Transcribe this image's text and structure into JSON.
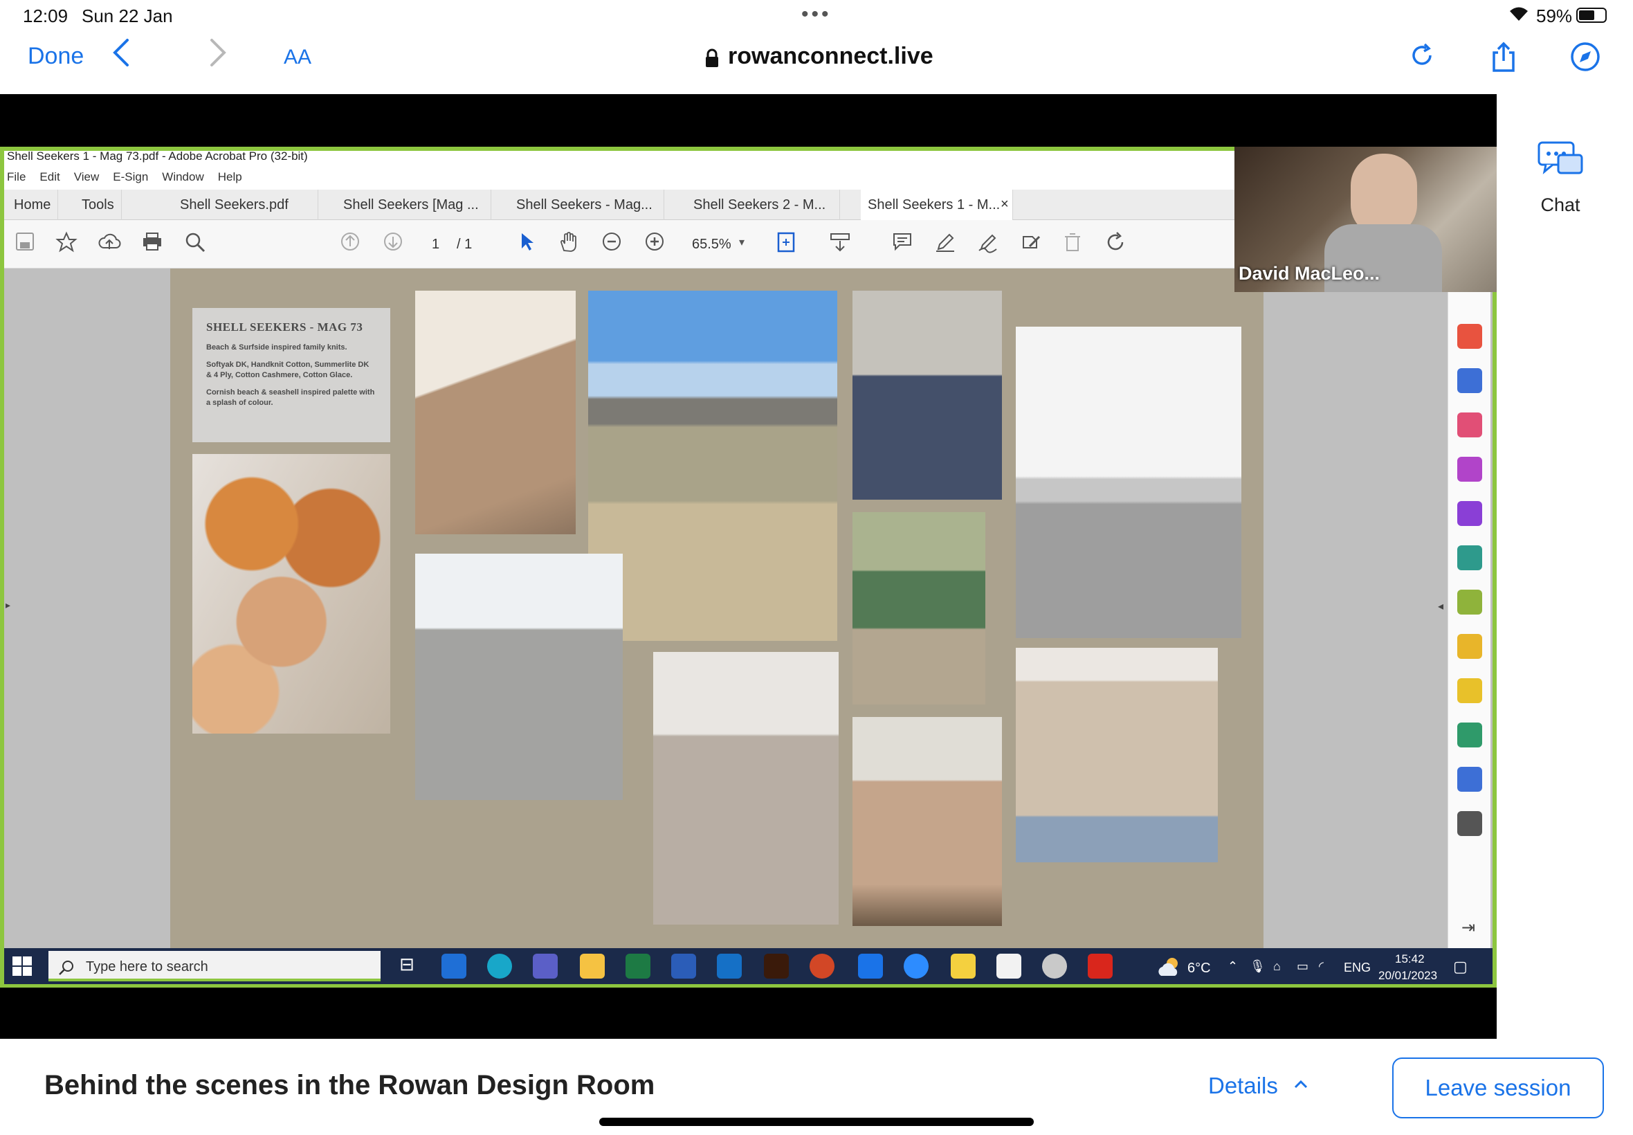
{
  "status_bar": {
    "time": "12:09",
    "date": "Sun 22 Jan",
    "battery": "59%"
  },
  "browser": {
    "done_label": "Done",
    "aa_label": "AA",
    "url": "rowanconnect.live"
  },
  "side_panel": {
    "chat_label": "Chat"
  },
  "acrobat": {
    "window_title": "Shell Seekers 1 - Mag 73.pdf - Adobe Acrobat Pro (32-bit)",
    "menu": [
      "File",
      "Edit",
      "View",
      "E-Sign",
      "Window",
      "Help"
    ],
    "tabs": [
      {
        "label": "Home"
      },
      {
        "label": "Tools"
      },
      {
        "label": "Shell Seekers.pdf"
      },
      {
        "label": "Shell Seekers [Mag ..."
      },
      {
        "label": "Shell Seekers - Mag..."
      },
      {
        "label": "Shell Seekers 2 - M..."
      },
      {
        "label": "Shell Seekers 1 - M..."
      }
    ],
    "tab_close": "×",
    "page_current": "1",
    "page_total": "/ 1",
    "zoom": "65.5%"
  },
  "moodboard": {
    "title": "SHELL SEEKERS - MAG 73",
    "subtitle": "Beach & Surfside inspired family knits.",
    "yarns": "Softyak DK, Handknit Cotton, Summerlite DK & 4 Ply, Cotton Cashmere, Cotton Glace.",
    "palette": "Cornish beach & seashell inspired palette with a splash of colour."
  },
  "speaker": {
    "name": "David MacLeo..."
  },
  "taskbar": {
    "search_placeholder": "Type here to search",
    "weather": "6°C",
    "language": "ENG",
    "time": "15:42",
    "date": "20/01/2023"
  },
  "session": {
    "title": "Behind the scenes in the Rowan Design Room",
    "details_label": "Details",
    "leave_label": "Leave session"
  }
}
